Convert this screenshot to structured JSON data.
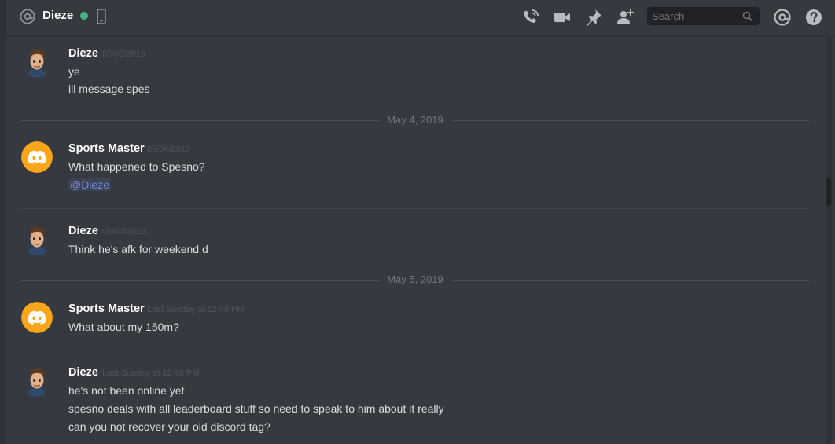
{
  "header": {
    "channel_name": "Dieze",
    "search_placeholder": "Search"
  },
  "dividers": [
    "May 4, 2019",
    "May 5, 2019"
  ],
  "messages": [
    {
      "author": "Dieze",
      "timestamp": "05/03/2019",
      "lines": [
        "ye",
        "ill message spes"
      ]
    },
    {
      "author": "Sports Master",
      "timestamp": "05/04/2019",
      "lines": [
        "What happened to Spesno?"
      ],
      "mention": "@Dieze"
    },
    {
      "author": "Dieze",
      "timestamp": "05/04/2019",
      "lines": [
        "Think he's afk for weekend d"
      ]
    },
    {
      "author": "Sports Master",
      "timestamp": "Last Sunday at 12:48 PM",
      "lines": [
        "What about my 150m?"
      ]
    },
    {
      "author": "Dieze",
      "timestamp": "Last Sunday at 12:48 PM",
      "lines": [
        "he's not been online yet",
        "spesno deals with all leaderboard stuff so need to speak to him about it really",
        "can you not recover your old discord tag?"
      ]
    }
  ],
  "icons": {
    "header": [
      "at-icon",
      "online-status-icon",
      "mobile-icon",
      "call-icon",
      "video-icon",
      "pin-icon",
      "add-friend-icon",
      "search-icon",
      "mentions-icon",
      "help-icon"
    ],
    "avatars": [
      "dieze-avatar",
      "discord-logo-avatar"
    ]
  },
  "colors": {
    "background": "#36393f",
    "header_background": "#36393f",
    "online": "#43b581",
    "mention": "#7289da",
    "discord_avatar": "#faa61a",
    "text": "#dcddde",
    "muted": "#72767d"
  }
}
